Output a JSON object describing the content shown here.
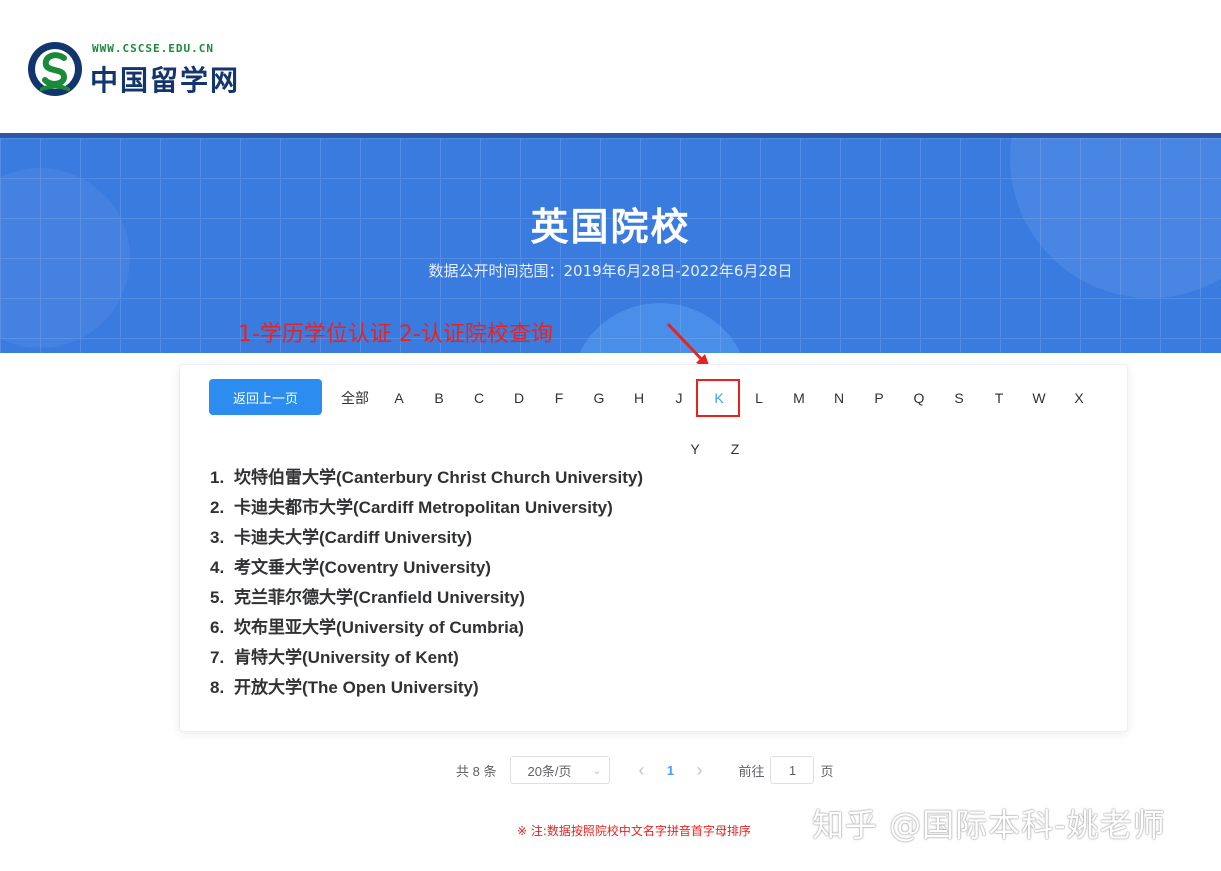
{
  "logo": {
    "url": "WWW.CSCSE.EDU.CN",
    "name": "中国留学网"
  },
  "banner": {
    "title": "英国院校",
    "subtitle": "数据公开时间范围：2019年6月28日-2022年6月28日"
  },
  "annotation": {
    "text": "1-学历学位认证  2-认证院校查询",
    "color": "#e8231f"
  },
  "filter": {
    "back_label": "返回上一页",
    "all_label": "全部",
    "letters": [
      "A",
      "B",
      "C",
      "D",
      "F",
      "G",
      "H",
      "J",
      "K",
      "L",
      "M",
      "N",
      "P",
      "Q",
      "S",
      "T",
      "W",
      "X",
      "Y",
      "Z"
    ],
    "selected": "K"
  },
  "universities": [
    {
      "num": "1.",
      "name": "坎特伯雷大学(Canterbury Christ Church University)"
    },
    {
      "num": "2.",
      "name": "卡迪夫都市大学(Cardiff Metropolitan University)"
    },
    {
      "num": "3.",
      "name": "卡迪夫大学(Cardiff University)"
    },
    {
      "num": "4.",
      "name": "考文垂大学(Coventry University)"
    },
    {
      "num": "5.",
      "name": "克兰菲尔德大学(Cranfield University)"
    },
    {
      "num": "6.",
      "name": "坎布里亚大学(University of Cumbria)"
    },
    {
      "num": "7.",
      "name": "肯特大学(University of Kent)"
    },
    {
      "num": "8.",
      "name": "开放大学(The Open University)"
    }
  ],
  "pagination": {
    "total": "共 8 条",
    "page_size": "20条/页",
    "current_page": "1",
    "goto_label": "前往",
    "goto_value": "1",
    "page_unit": "页"
  },
  "note": "※ 注:数据按照院校中文名字拼音首字母排序",
  "watermark": "知乎 @国际本科-姚老师",
  "colors": {
    "accent": "#409eff",
    "button": "#2d8cf0",
    "banner": "#3a7be0"
  }
}
